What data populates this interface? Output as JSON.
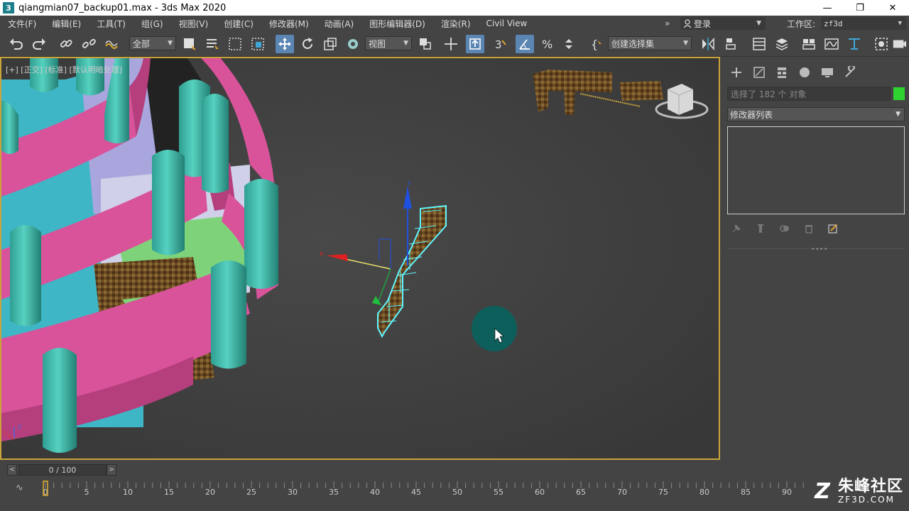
{
  "titlebar": {
    "app_icon_text": "3",
    "title": "qiangmian07_backup01.max - 3ds Max 2020",
    "minimize": "—",
    "maximize": "❐",
    "close": "✕"
  },
  "menu": {
    "items": [
      "文件(F)",
      "编辑(E)",
      "工具(T)",
      "组(G)",
      "视图(V)",
      "创建(C)",
      "修改器(M)",
      "动画(A)",
      "图形编辑器(D)",
      "渲染(R)",
      "Civil View"
    ],
    "more": "»",
    "login_label": "登录",
    "workspace_label": "工作区:",
    "workspace_value": "zf3d"
  },
  "toolbar": {
    "selection_filter": "全部",
    "ref_coord": "视图",
    "named_selection": "创建选择集"
  },
  "viewport": {
    "label": "[+] [正交] [标准] [默认明暗处理]",
    "axis_x": "x",
    "axis_z": "z",
    "gizmo_x": "x",
    "gizmo_z": "z"
  },
  "command_panel": {
    "tab_icons": [
      "create-icon",
      "modify-icon",
      "hierarchy-icon",
      "motion-icon",
      "display-icon",
      "utilities-icon"
    ],
    "selection_text": "选择了 182 个 对象",
    "modifier_list": "修改器列表"
  },
  "timeslider": {
    "frame_text": "0 / 100",
    "prev": "<",
    "next": ">"
  },
  "trackbar": {
    "ticks": [
      0,
      5,
      10,
      15,
      20,
      25,
      30,
      35,
      40,
      45,
      50,
      55,
      60,
      65,
      70,
      75,
      80,
      85,
      90,
      95
    ],
    "logo_cn": "朱峰社区",
    "logo_en": "ZF3D.COM",
    "logo_mark": "Z"
  },
  "colors": {
    "accent": "#5b86b3",
    "viewport_border": "#c9a43b",
    "object_color": "#2fd32f",
    "selection_highlight": "#5ff5ff"
  }
}
